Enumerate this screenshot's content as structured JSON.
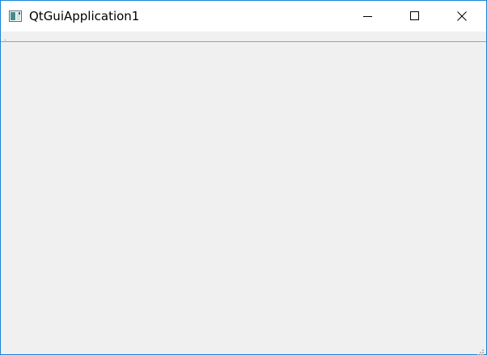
{
  "window": {
    "title": "QtGuiApplication1",
    "icon": "qt-app-window-icon",
    "controls": {
      "minimize": "minimize-icon",
      "maximize": "maximize-icon",
      "close": "close-icon"
    },
    "border_color": "#1883d7"
  },
  "toolbar": {
    "handle": "toolbar-grip-icon"
  },
  "statusbar": {
    "size_grip": "size-grip-icon"
  }
}
